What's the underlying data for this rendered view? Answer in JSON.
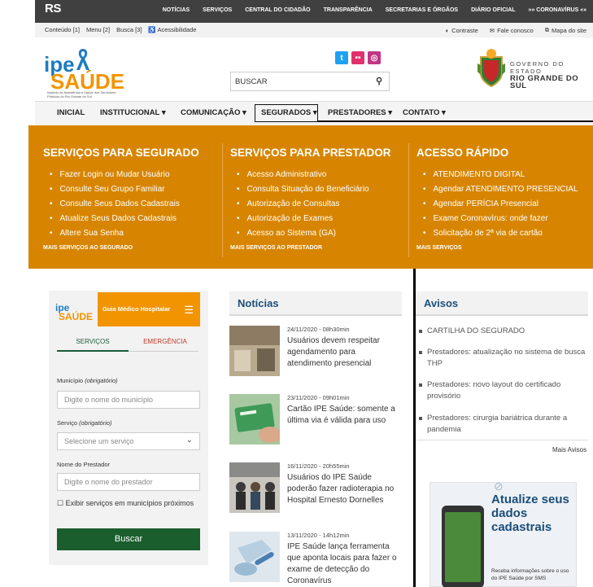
{
  "topbar": {
    "logo": "RS",
    "nav": [
      "NOTÍCIAS",
      "SERVIÇOS",
      "CENTRAL DO CIDADÃO",
      "TRANSPARÊNCIA",
      "SECRETARIAS E ÓRGÃOS",
      "DIÁRIO OFICIAL",
      "»» CORONAVÍRUS «»"
    ]
  },
  "accessbar": {
    "content": "Conteúdo [1]",
    "menu": "Menu [2]",
    "busca": "Busca [3]",
    "acessibilidade": "Acessibilidade",
    "contraste": "Contraste",
    "fale": "Fale conosco",
    "mapa": "Mapa do site"
  },
  "header": {
    "logo_ipe": "ipe",
    "logo_saude": "SAÚDE",
    "logo_sub": "Instituto de Assistência à Saúde dos Servidores Públicos do Rio Grande do Sul",
    "search_placeholder": "BUSCAR",
    "gov_line1": "GOVERNO DO ESTADO",
    "gov_line2": "RIO GRANDE DO SUL"
  },
  "mainnav": {
    "items": [
      "INICIAL",
      "INSTITUCIONAL ▾",
      "COMUNICAÇÃO ▾",
      "SEGURADOS ▾",
      "PRESTADORES ▾",
      "CONTATO ▾"
    ]
  },
  "band": {
    "col1": {
      "title": "SERVIÇOS PARA SEGURADO",
      "items": [
        "Fazer Login ou Mudar Usuário",
        "Consulte Seu Grupo Familiar",
        "Consulte Seus Dados Cadastrais",
        "Atualize Seus Dados Cadastrais",
        "Altere Sua Senha"
      ],
      "more": "MAIS SERVIÇOS AO SEGURADO"
    },
    "col2": {
      "title": "SERVIÇOS PARA PRESTADOR",
      "items": [
        "Acesso Administrativo",
        "Consulta Situação do Beneficiário",
        "Autorização de Consultas",
        "Autorização de Exames",
        "Acesso ao Sistema (GA)"
      ],
      "more": "MAIS SERVIÇOS AO PRESTADOR"
    },
    "col3": {
      "title": "ACESSO RÁPIDO",
      "items": [
        "ATENDIMENTO DIGITAL",
        "Agendar ATENDIMENTO PRESENCIAL",
        "Agendar PERÍCIA Presencial",
        "Exame Coronavírus: onde fazer",
        "Solicitação de 2ª via de cartão"
      ],
      "more": "MAIS SERVIÇOS"
    }
  },
  "widget": {
    "logo_ipe": "ipe",
    "logo_saude": "SAÚDE",
    "title": "Guia Médico Hospitalar",
    "tab_servicos": "SERVIÇOS",
    "tab_emergencia": "EMERGÊNCIA",
    "municipio_label": "Município",
    "municipio_req": "(obrigatório)",
    "municipio_ph": "Digite o nome do município",
    "servico_label": "Serviço",
    "servico_req": "(obrigatório)",
    "servico_ph": "Selecione um serviço",
    "prestador_label": "Nome do Prestador",
    "prestador_ph": "Digite o nome do prestador",
    "checkbox": "Exibir serviços em municípios próximos",
    "button": "Buscar"
  },
  "news": {
    "title": "Notícias",
    "items": [
      {
        "date": "24/11/2020 - 08h30min",
        "text": "Usuários devem respeitar agendamento para atendimento presencial"
      },
      {
        "date": "23/11/2020 - 09h01min",
        "text": "Cartão IPE Saúde: somente a última via é válida para uso"
      },
      {
        "date": "16/11/2020 - 20h55min",
        "text": "Usuários do IPE Saúde poderão fazer radioterapia no Hospital Ernesto Dornelles"
      },
      {
        "date": "13/11/2020 - 14h12min",
        "text": "IPE Saúde lança ferramenta que aponta locais para fazer o exame de detecção do Coronavírus"
      }
    ]
  },
  "avisos": {
    "title": "Avisos",
    "items": [
      "CARTILHA DO SEGURADO",
      "Prestadores: atualização no sistema de busca THP",
      "Prestadores: novo layout do certificado provisório",
      "Prestadores: cirurgia bariátrica durante a pandemia"
    ],
    "more": "Mais Avisos"
  },
  "ad": {
    "title": "Atualize seus dados cadastrais",
    "sub": "Receba informações sobre o uso do IPE Saúde por SMS"
  },
  "colors": {
    "orange_band": "#d78500",
    "ipe_blue": "#1e7cc2",
    "saude_orange": "#f29400",
    "heading_blue": "#1a4f7a",
    "button_green": "#1a5e2e"
  }
}
